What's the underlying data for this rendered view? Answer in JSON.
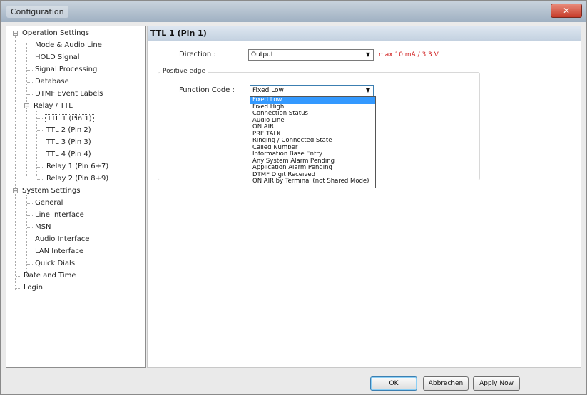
{
  "window": {
    "title": "Configuration",
    "close_glyph": "✕"
  },
  "tree": {
    "operation_settings": "Operation Settings",
    "mode_audio_line": "Mode & Audio Line",
    "hold_signal": "HOLD Signal",
    "signal_processing": "Signal Processing",
    "database": "Database",
    "dtmf_event_labels": "DTMF Event Labels",
    "relay_ttl": "Relay / TTL",
    "ttl1": "TTL 1 (Pin 1)",
    "ttl2": "TTL 2 (Pin 2)",
    "ttl3": "TTL 3 (Pin 3)",
    "ttl4": "TTL 4 (Pin 4)",
    "relay1": "Relay 1 (Pin 6+7)",
    "relay2": "Relay 2 (Pin 8+9)",
    "system_settings": "System Settings",
    "general": "General",
    "line_interface": "Line Interface",
    "msn": "MSN",
    "audio_interface": "Audio Interface",
    "lan_interface": "LAN Interface",
    "quick_dials": "Quick Dials",
    "date_and_time": "Date and Time",
    "login": "Login",
    "collapse_glyph": "−"
  },
  "panel": {
    "title": "TTL 1 (Pin 1)",
    "direction_label": "Direction :",
    "direction_value": "Output",
    "max_note": "max 10 mA / 3.3 V",
    "positive_edge_legend": "Positive edge",
    "function_code_label": "Function Code :",
    "function_code_value": "Fixed Low",
    "dropdown_arrow": "▼"
  },
  "dropdown_options": [
    "Fixed Low",
    "Fixed High",
    "Connection Status",
    "Audio Line",
    "ON AIR",
    "PRE TALK",
    "Ringing / Connected State",
    "Called Number",
    "Information Base Entry",
    "Any System Alarm Pending",
    "Application Alarm Pending",
    "DTMF Digit Received",
    "ON AIR by Terminal (not Shared Mode)"
  ],
  "buttons": {
    "ok": "OK",
    "cancel": "Abbrechen",
    "apply": "Apply Now"
  },
  "colors": {
    "selection": "#3399ff",
    "warning": "#d02020"
  }
}
